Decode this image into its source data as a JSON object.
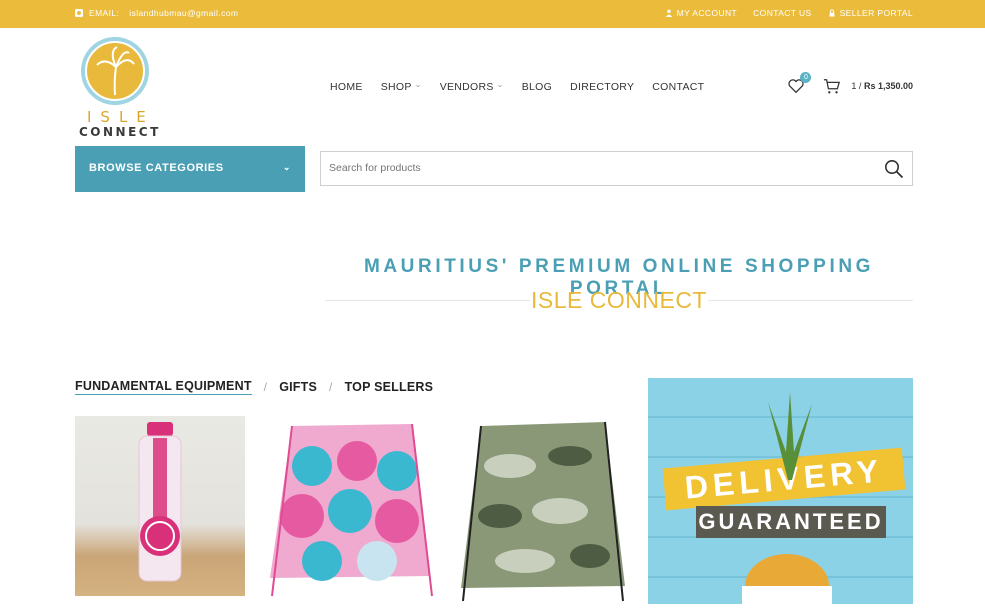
{
  "topbar": {
    "email_label": "EMAIL:",
    "email_value": "islandhubmau@gmail.com",
    "my_account": "MY ACCOUNT",
    "contact_us": "CONTACT US",
    "seller_portal": "SELLER PORTAL",
    "bg_color": "#ebbb3b"
  },
  "logo": {
    "line1": "ISLE",
    "line2": "CONNECT"
  },
  "nav": {
    "items": [
      "HOME",
      "SHOP",
      "VENDORS",
      "BLOG",
      "DIRECTORY",
      "CONTACT"
    ]
  },
  "header": {
    "wishlist_count": "0",
    "cart_count": "1 /",
    "cart_total": "Rs 1,350.00"
  },
  "browse": {
    "label": "BROWSE CATEGORIES",
    "color": "#4b9fb5"
  },
  "search": {
    "placeholder": "Search for products"
  },
  "hero": {
    "tagline": "MAURITIUS' PREMIUM ONLINE SHOPPING PORTAL",
    "subtitle": "ISLE CONNECT"
  },
  "tabs": [
    "FUNDAMENTAL EQUIPMENT",
    "GIFTS",
    "TOP SELLERS"
  ],
  "banner": {
    "line1": "DELIVERY",
    "line2": "GUARANTEED"
  }
}
